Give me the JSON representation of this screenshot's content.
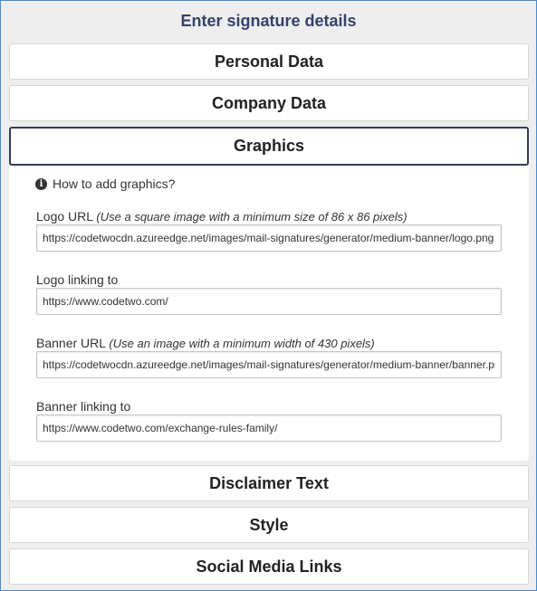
{
  "header": {
    "title": "Enter signature details"
  },
  "sections": {
    "personal": "Personal Data",
    "company": "Company Data",
    "graphics": "Graphics",
    "disclaimer": "Disclaimer Text",
    "style": "Style",
    "social": "Social Media Links"
  },
  "graphics": {
    "help_link": "How to add graphics?",
    "logo_url": {
      "label": "Logo URL",
      "hint": "(Use a square image with a minimum size of 86 x 86 pixels)",
      "value": "https://codetwocdn.azureedge.net/images/mail-signatures/generator/medium-banner/logo.png"
    },
    "logo_link": {
      "label": "Logo linking to",
      "value": "https://www.codetwo.com/"
    },
    "banner_url": {
      "label": "Banner URL",
      "hint": "(Use an image with a minimum width of 430 pixels)",
      "value": "https://codetwocdn.azureedge.net/images/mail-signatures/generator/medium-banner/banner.png"
    },
    "banner_link": {
      "label": "Banner linking to",
      "value": "https://www.codetwo.com/exchange-rules-family/"
    }
  }
}
